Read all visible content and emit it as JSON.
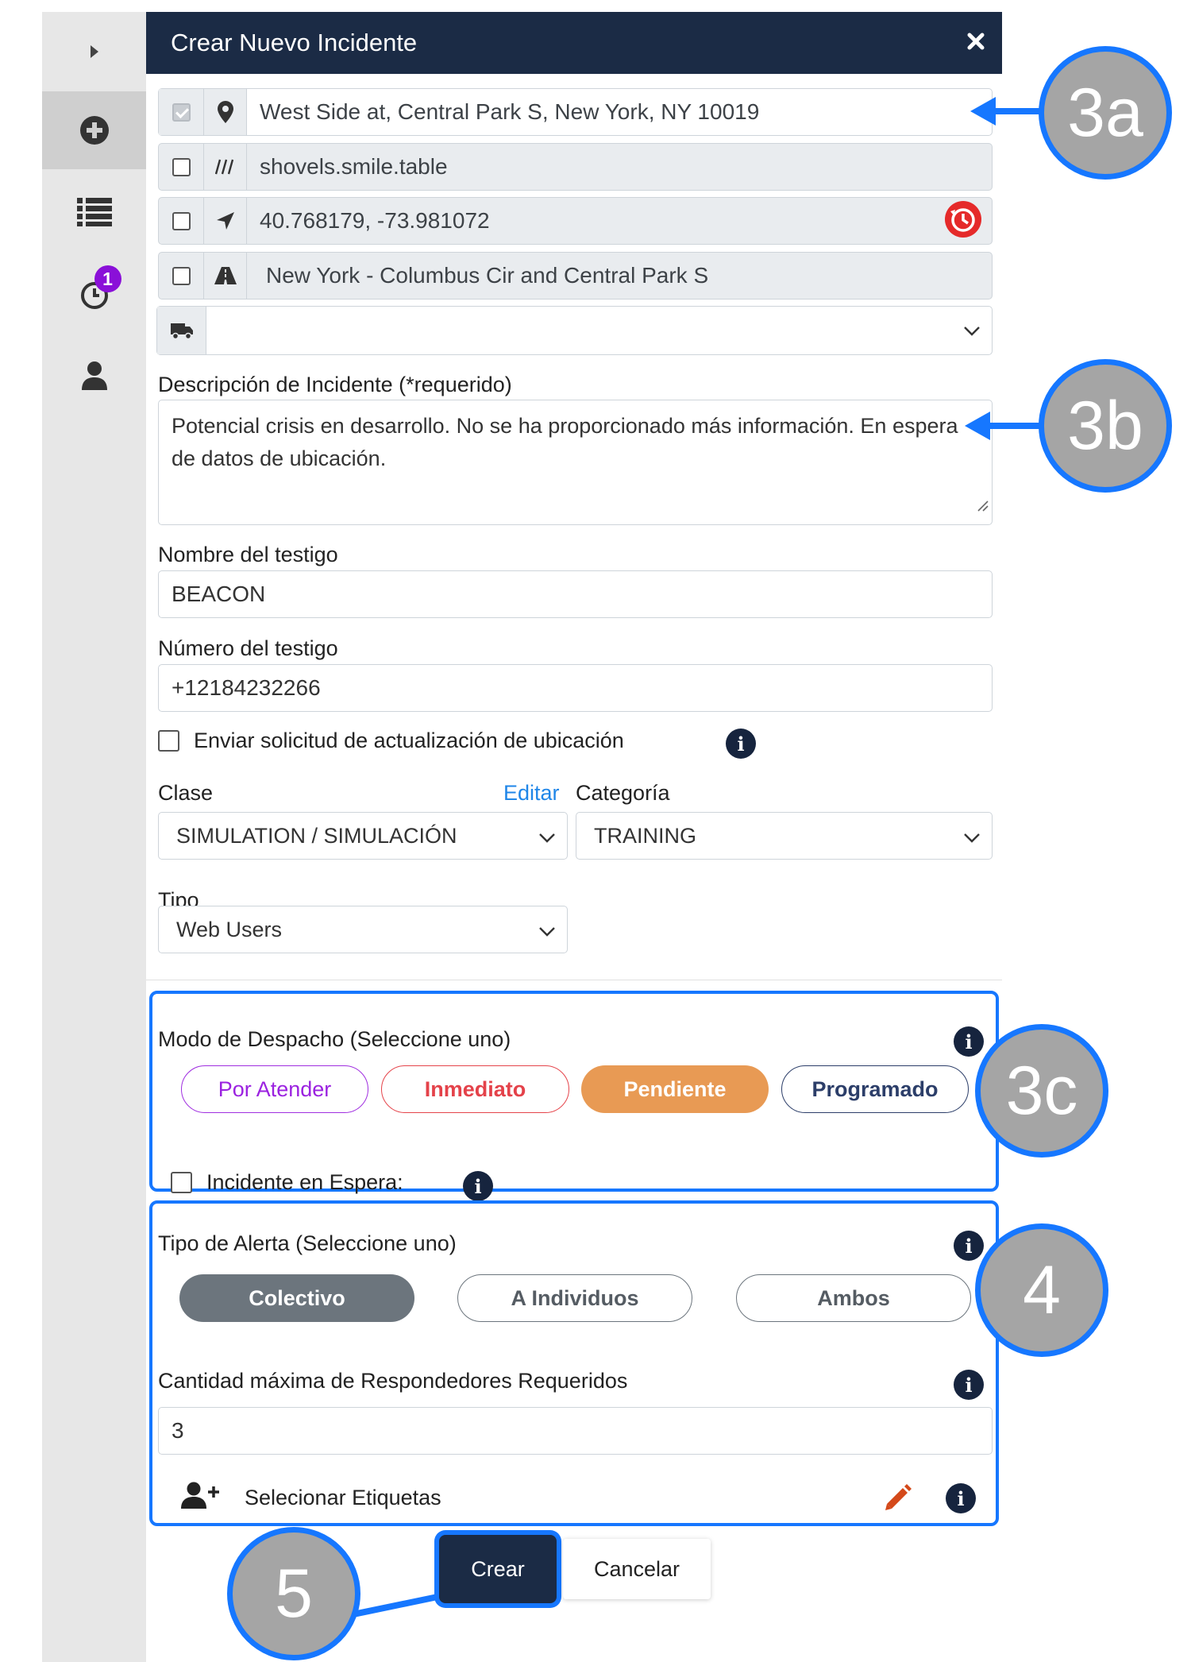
{
  "sidebar": {
    "badge_count": "1",
    "items": [
      {
        "icon": "caret-right-icon"
      },
      {
        "icon": "plus-circle-icon"
      },
      {
        "icon": "list-icon"
      },
      {
        "icon": "history-icon"
      },
      {
        "icon": "user-icon"
      }
    ]
  },
  "dialog": {
    "title": "Crear Nuevo Incidente",
    "close_icon": "close-icon"
  },
  "location": {
    "address": "West Side at, Central Park S, New York, NY 10019",
    "what3words": "shovels.smile.table",
    "coordinates": "40.768179, -73.981072",
    "road": "New York -  Columbus Cir and Central Park S",
    "vehicle_value": ""
  },
  "form": {
    "description_label": "Descripción de Incidente (*requerido)",
    "description_value": "Potencial crisis en desarrollo. No se ha proporcionado más información. En espera de datos de ubicación.",
    "witness_name_label": "Nombre del testigo",
    "witness_name_value": "BEACON",
    "witness_number_label": "Número del testigo",
    "witness_number_value": "+12184232266",
    "send_location_label": "Enviar solicitud de actualización de ubicación",
    "class_label": "Clase",
    "edit_link": "Editar",
    "category_label": "Categoría",
    "class_value": "SIMULATION / SIMULACIÓN",
    "category_value": "TRAINING",
    "type_label": "Tipo",
    "type_value": "Web Users"
  },
  "dispatch": {
    "title": "Modo de Despacho (Seleccione uno)",
    "modes": [
      "Por Atender",
      "Inmediato",
      "Pendiente",
      "Programado"
    ],
    "selected": "Pendiente",
    "on_hold_label": "Incidente en Espera:"
  },
  "alert": {
    "title": "Tipo de Alerta (Seleccione uno)",
    "options": [
      "Colectivo",
      "A Individuos",
      "Ambos"
    ],
    "selected": "Colectivo",
    "max_responders_label": "Cantidad máxima de Respondedores Requeridos",
    "max_responders_value": "3",
    "tags_label": "Selecionar Etiquetas"
  },
  "actions": {
    "create": "Crear",
    "cancel": "Cancelar"
  },
  "callouts": [
    "3a",
    "3b",
    "3c",
    "4",
    "5"
  ],
  "colors": {
    "header_bg": "#1b2b45",
    "callout_border": "#1677ff",
    "callout_fill": "#a5a5a5",
    "pendiente": "#e89a54",
    "inmediato": "#e4424a",
    "por_atender": "#9b22e0",
    "link": "#1f86e8"
  }
}
